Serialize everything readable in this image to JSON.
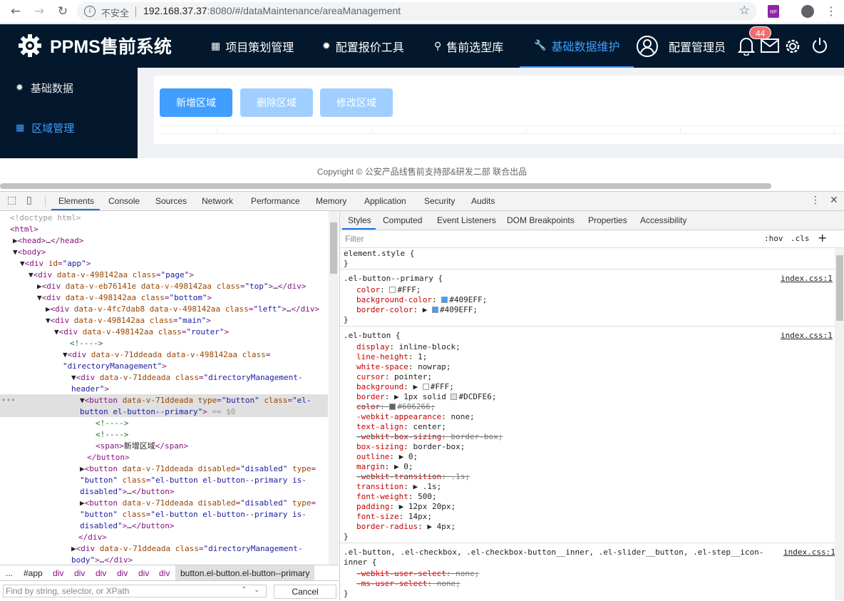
{
  "browser": {
    "security_label": "不安全",
    "url_host": "192.168.37.37",
    "url_rest": ":8080/#/dataMaintenance/areaManagement",
    "ext_badge": "RP"
  },
  "app": {
    "logo_text": "PPMS售前系统",
    "nav": [
      {
        "label": "项目策划管理",
        "icon": "grid-icon"
      },
      {
        "label": "配置报价工具",
        "icon": "gear-icon"
      },
      {
        "label": "售前选型库",
        "icon": "location-icon"
      },
      {
        "label": "基础数据维护",
        "icon": "wrench-icon",
        "active": true
      }
    ],
    "user_name": "配置管理员",
    "notification_count": "44",
    "sidebar": [
      {
        "label": "基础数据",
        "icon": "gear-icon"
      },
      {
        "label": "区域管理",
        "icon": "grid-icon",
        "active": true
      }
    ],
    "buttons": {
      "add": "新增区域",
      "delete": "删除区域",
      "edit": "修改区域"
    },
    "footer": "Copyright © 公安产品线售前支持部&研发二部 联合出品",
    "accent_color": "#409EFF",
    "header_bg": "#03182C"
  },
  "devtools": {
    "tabs": [
      "Elements",
      "Console",
      "Sources",
      "Network",
      "Performance",
      "Memory",
      "Application",
      "Security",
      "Audits"
    ],
    "styles_tabs": [
      "Styles",
      "Computed",
      "Event Listeners",
      "DOM Breakpoints",
      "Properties",
      "Accessibility"
    ],
    "filter_placeholder": "Filter",
    "hov": ":hov",
    "cls": ".cls",
    "find_placeholder": "Find by string, selector, or XPath",
    "cancel": "Cancel",
    "breadcrumbs": [
      "...",
      "#app",
      "div",
      "div",
      "div",
      "div",
      "div",
      "div",
      "button.el-button.el-button--primary"
    ],
    "source_link": "index.css:1"
  }
}
